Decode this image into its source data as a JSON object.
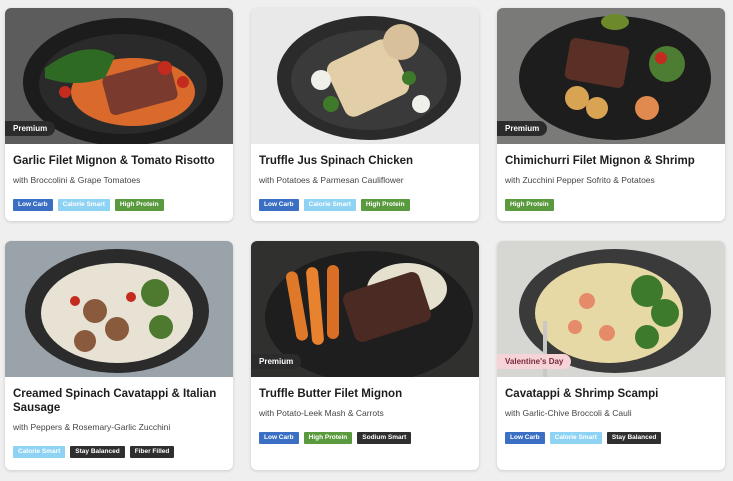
{
  "colors": {
    "low_carb": "#3b6fc4",
    "calorie_smart": "#8ed3f4",
    "high_protein": "#5a9a3f",
    "stay_balanced": "#2f2f2f",
    "fiber_filled": "#2f2f2f",
    "sodium_smart": "#2f2f2f"
  },
  "meals": [
    {
      "title": "Garlic Filet Mignon & Tomato Risotto",
      "subtitle": "with Broccolini & Grape Tomatoes",
      "tag": "Premium",
      "badges": [
        "Low Carb",
        "Calorie Smart",
        "High Protein"
      ]
    },
    {
      "title": "Truffle Jus Spinach Chicken",
      "subtitle": "with Potatoes & Parmesan Cauliflower",
      "tag": "",
      "badges": [
        "Low Carb",
        "Calorie Smart",
        "High Protein"
      ]
    },
    {
      "title": "Chimichurri Filet Mignon & Shrimp",
      "subtitle": "with Zucchini Pepper Sofrito & Potatoes",
      "tag": "Premium",
      "badges": [
        "High Protein"
      ]
    },
    {
      "title": "Creamed Spinach Cavatappi & Italian Sausage",
      "subtitle": "with Peppers & Rosemary-Garlic Zucchini",
      "tag": "",
      "badges": [
        "Calorie Smart",
        "Stay Balanced",
        "Fiber Filled"
      ]
    },
    {
      "title": "Truffle Butter Filet Mignon",
      "subtitle": "with Potato-Leek Mash & Carrots",
      "tag": "Premium",
      "badges": [
        "Low Carb",
        "High Protein",
        "Sodium Smart"
      ]
    },
    {
      "title": "Cavatappi & Shrimp Scampi",
      "subtitle": "with Garlic-Chive Broccoli & Cauli",
      "tag": "Valentine's Day",
      "badges": [
        "Low Carb",
        "Calorie Smart",
        "Stay Balanced"
      ]
    }
  ]
}
